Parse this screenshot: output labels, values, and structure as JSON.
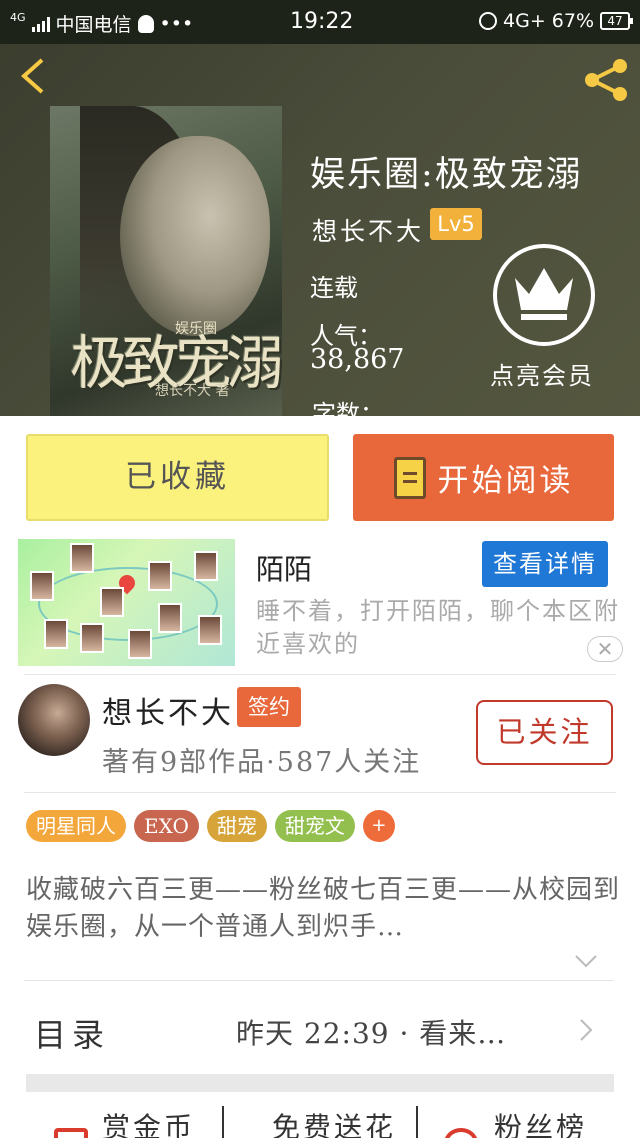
{
  "status_bar": {
    "network_label": "4G",
    "carrier": "中国电信",
    "more": "•••",
    "time": "19:22",
    "signal_type": "4G+",
    "battery_percent": "67%",
    "battery_icon_text": "47"
  },
  "header": {
    "back_icon": "chevron-left-icon",
    "share_icon": "share-icon"
  },
  "book": {
    "cover_title": "极致宠溺",
    "cover_subtitle": "娱乐圈",
    "cover_author": "想长不大 著",
    "title": "娱乐圈:极致宠溺",
    "author": "想长不大",
    "level": "Lv5",
    "status": "连载",
    "popularity_label": "人气：",
    "popularity_value": "38,867",
    "word_count_label": "字数：",
    "vip_label": "点亮会员"
  },
  "buttons": {
    "favorited": "已收藏",
    "start_reading": "开始阅读"
  },
  "ad": {
    "title": "陌陌",
    "detail_button": "查看详情",
    "description": "睡不着，打开陌陌，聊个本区附近喜欢的",
    "close": "✕"
  },
  "author_card": {
    "name": "想长不大",
    "badge": "签约",
    "meta": "著有9部作品·587人关注",
    "follow_button": "已关注"
  },
  "tags": [
    {
      "label": "明星同人",
      "color": "#f3a63a"
    },
    {
      "label": "EXO",
      "color": "#c9664f"
    },
    {
      "label": "甜宠",
      "color": "#d7a43a"
    },
    {
      "label": "甜宠文",
      "color": "#93bf4f"
    },
    {
      "label": "+",
      "color": "#ee6c3a"
    }
  ],
  "summary": "收藏破六百三更——粉丝破七百三更——从校园到娱乐圈，从一个普通人到炽手…",
  "toc": {
    "label": "目录",
    "update": "昨天 22:39 · 看来…"
  },
  "bottom_actions": [
    {
      "label": "赏金币",
      "icon": "coin-icon"
    },
    {
      "label": "免费送花",
      "icon": "flower-icon"
    },
    {
      "label": "粉丝榜",
      "icon": "fans-icon"
    }
  ]
}
